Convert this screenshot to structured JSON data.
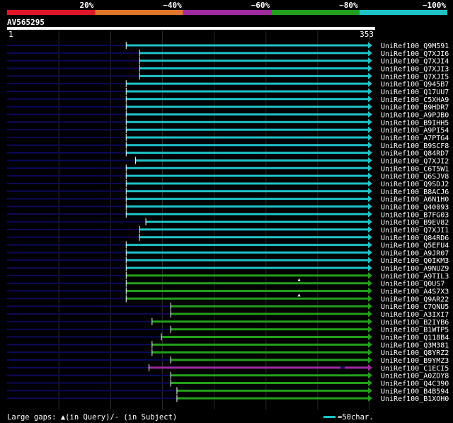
{
  "query": {
    "name": "AV565295",
    "start": "1",
    "end": "353"
  },
  "legend": {
    "bins": [
      {
        "label": "20%",
        "color": "#e0162a"
      },
      {
        "label": "~40%",
        "color": "#e0762a"
      },
      {
        "label": "~60%",
        "color": "#a02aa0"
      },
      {
        "label": "~80%",
        "color": "#22a01a"
      },
      {
        "label": "~100%",
        "color": "#1ec3c8"
      }
    ]
  },
  "colors": {
    "dark": "#0a0a5a",
    "cyan": "#1ec3c8",
    "green": "#22a01a",
    "purple": "#a02aa0"
  },
  "footer": {
    "gaps_text": "Large gaps: ▲(in Query)/- (in Subject)",
    "scale_text": "=50char."
  },
  "chart_data": {
    "type": "alignment",
    "x_range": [
      1,
      353
    ],
    "hits": [
      {
        "name": "UniRef100_Q9M591",
        "start": 116,
        "end": 353,
        "color": "cyan"
      },
      {
        "name": "UniRef100_Q7XJI6",
        "start": 129,
        "end": 353,
        "color": "cyan"
      },
      {
        "name": "UniRef100_Q7XJI4",
        "start": 129,
        "end": 353,
        "color": "cyan"
      },
      {
        "name": "UniRef100_Q7XJI3",
        "start": 129,
        "end": 353,
        "color": "cyan"
      },
      {
        "name": "UniRef100_Q7XJI5",
        "start": 129,
        "end": 353,
        "color": "cyan"
      },
      {
        "name": "UniRef100_Q945B7",
        "start": 116,
        "end": 353,
        "color": "cyan"
      },
      {
        "name": "UniRef100_Q17UU7",
        "start": 116,
        "end": 353,
        "color": "cyan"
      },
      {
        "name": "UniRef100_C5XHA9",
        "start": 116,
        "end": 353,
        "color": "cyan"
      },
      {
        "name": "UniRef100_B9HDR7",
        "start": 116,
        "end": 353,
        "color": "cyan"
      },
      {
        "name": "UniRef100_A9PJB0",
        "start": 116,
        "end": 353,
        "color": "cyan"
      },
      {
        "name": "UniRef100_B9IHH5",
        "start": 116,
        "end": 353,
        "color": "cyan"
      },
      {
        "name": "UniRef100_A9PI54",
        "start": 116,
        "end": 353,
        "color": "cyan"
      },
      {
        "name": "UniRef100_A7PTG4",
        "start": 116,
        "end": 353,
        "color": "cyan"
      },
      {
        "name": "UniRef100_B9SCF8",
        "start": 116,
        "end": 353,
        "color": "cyan"
      },
      {
        "name": "UniRef100_Q84RD7",
        "start": 116,
        "end": 353,
        "color": "cyan"
      },
      {
        "name": "UniRef100_Q7XJI2",
        "start": 125,
        "end": 353,
        "color": "cyan"
      },
      {
        "name": "UniRef100_C6T5W1",
        "start": 116,
        "end": 353,
        "color": "cyan"
      },
      {
        "name": "UniRef100_Q6SJV8",
        "start": 116,
        "end": 353,
        "color": "cyan"
      },
      {
        "name": "UniRef100_Q9SDJ2",
        "start": 116,
        "end": 353,
        "color": "cyan"
      },
      {
        "name": "UniRef100_B8ACJ6",
        "start": 116,
        "end": 353,
        "color": "cyan"
      },
      {
        "name": "UniRef100_A6N1H0",
        "start": 116,
        "end": 353,
        "color": "cyan"
      },
      {
        "name": "UniRef100_Q40093",
        "start": 116,
        "end": 353,
        "color": "cyan"
      },
      {
        "name": "UniRef100_B7FG03",
        "start": 116,
        "end": 353,
        "color": "cyan"
      },
      {
        "name": "UniRef100_B9EV82",
        "start": 135,
        "end": 353,
        "color": "cyan"
      },
      {
        "name": "UniRef100_Q7XJI1",
        "start": 129,
        "end": 353,
        "color": "cyan"
      },
      {
        "name": "UniRef100_Q84RD6",
        "start": 129,
        "end": 353,
        "color": "cyan"
      },
      {
        "name": "UniRef100_Q5EFU4",
        "start": 116,
        "end": 353,
        "color": "cyan"
      },
      {
        "name": "UniRef100_A9JR07",
        "start": 116,
        "end": 353,
        "color": "cyan"
      },
      {
        "name": "UniRef100_Q0IKM3",
        "start": 116,
        "end": 353,
        "color": "cyan"
      },
      {
        "name": "UniRef100_A9NUZ9",
        "start": 116,
        "end": 353,
        "color": "cyan"
      },
      {
        "name": "UniRef100_A9TIL3",
        "start": 116,
        "end": 353,
        "color": "green"
      },
      {
        "name": "UniRef100_Q0US7",
        "start": 116,
        "end": 353,
        "color": "green",
        "query_gap": 283
      },
      {
        "name": "UniRef100_A4S7X3",
        "start": 116,
        "end": 353,
        "color": "green"
      },
      {
        "name": "UniRef100_Q9AR22",
        "start": 116,
        "end": 353,
        "color": "green",
        "query_gap": 283
      },
      {
        "name": "UniRef100_C7QNU5",
        "start": 159,
        "end": 353,
        "color": "green"
      },
      {
        "name": "UniRef100_A3IXI7",
        "start": 159,
        "end": 353,
        "color": "green"
      },
      {
        "name": "UniRef100_B2IYB6",
        "start": 141,
        "end": 353,
        "color": "green"
      },
      {
        "name": "UniRef100_B1WTP5",
        "start": 159,
        "end": 353,
        "color": "green"
      },
      {
        "name": "UniRef100_Q118B4",
        "start": 150,
        "end": 353,
        "color": "green"
      },
      {
        "name": "UniRef100_Q3M381",
        "start": 141,
        "end": 353,
        "color": "green"
      },
      {
        "name": "UniRef100_Q8YRZ2",
        "start": 141,
        "end": 353,
        "color": "green"
      },
      {
        "name": "UniRef100_B9YMZ3",
        "start": 159,
        "end": 353,
        "color": "green"
      },
      {
        "name": "UniRef100_C1ECI5",
        "start": 138,
        "end": 353,
        "color": "purple",
        "subject_gap": [
          323,
          327
        ]
      },
      {
        "name": "UniRef100_A0ZDY8",
        "start": 159,
        "end": 353,
        "color": "green"
      },
      {
        "name": "UniRef100_Q4C390",
        "start": 159,
        "end": 353,
        "color": "green"
      },
      {
        "name": "UniRef100_B4B594",
        "start": 165,
        "end": 353,
        "color": "green"
      },
      {
        "name": "UniRef100_B1XOH0",
        "start": 165,
        "end": 353,
        "color": "green"
      }
    ]
  }
}
